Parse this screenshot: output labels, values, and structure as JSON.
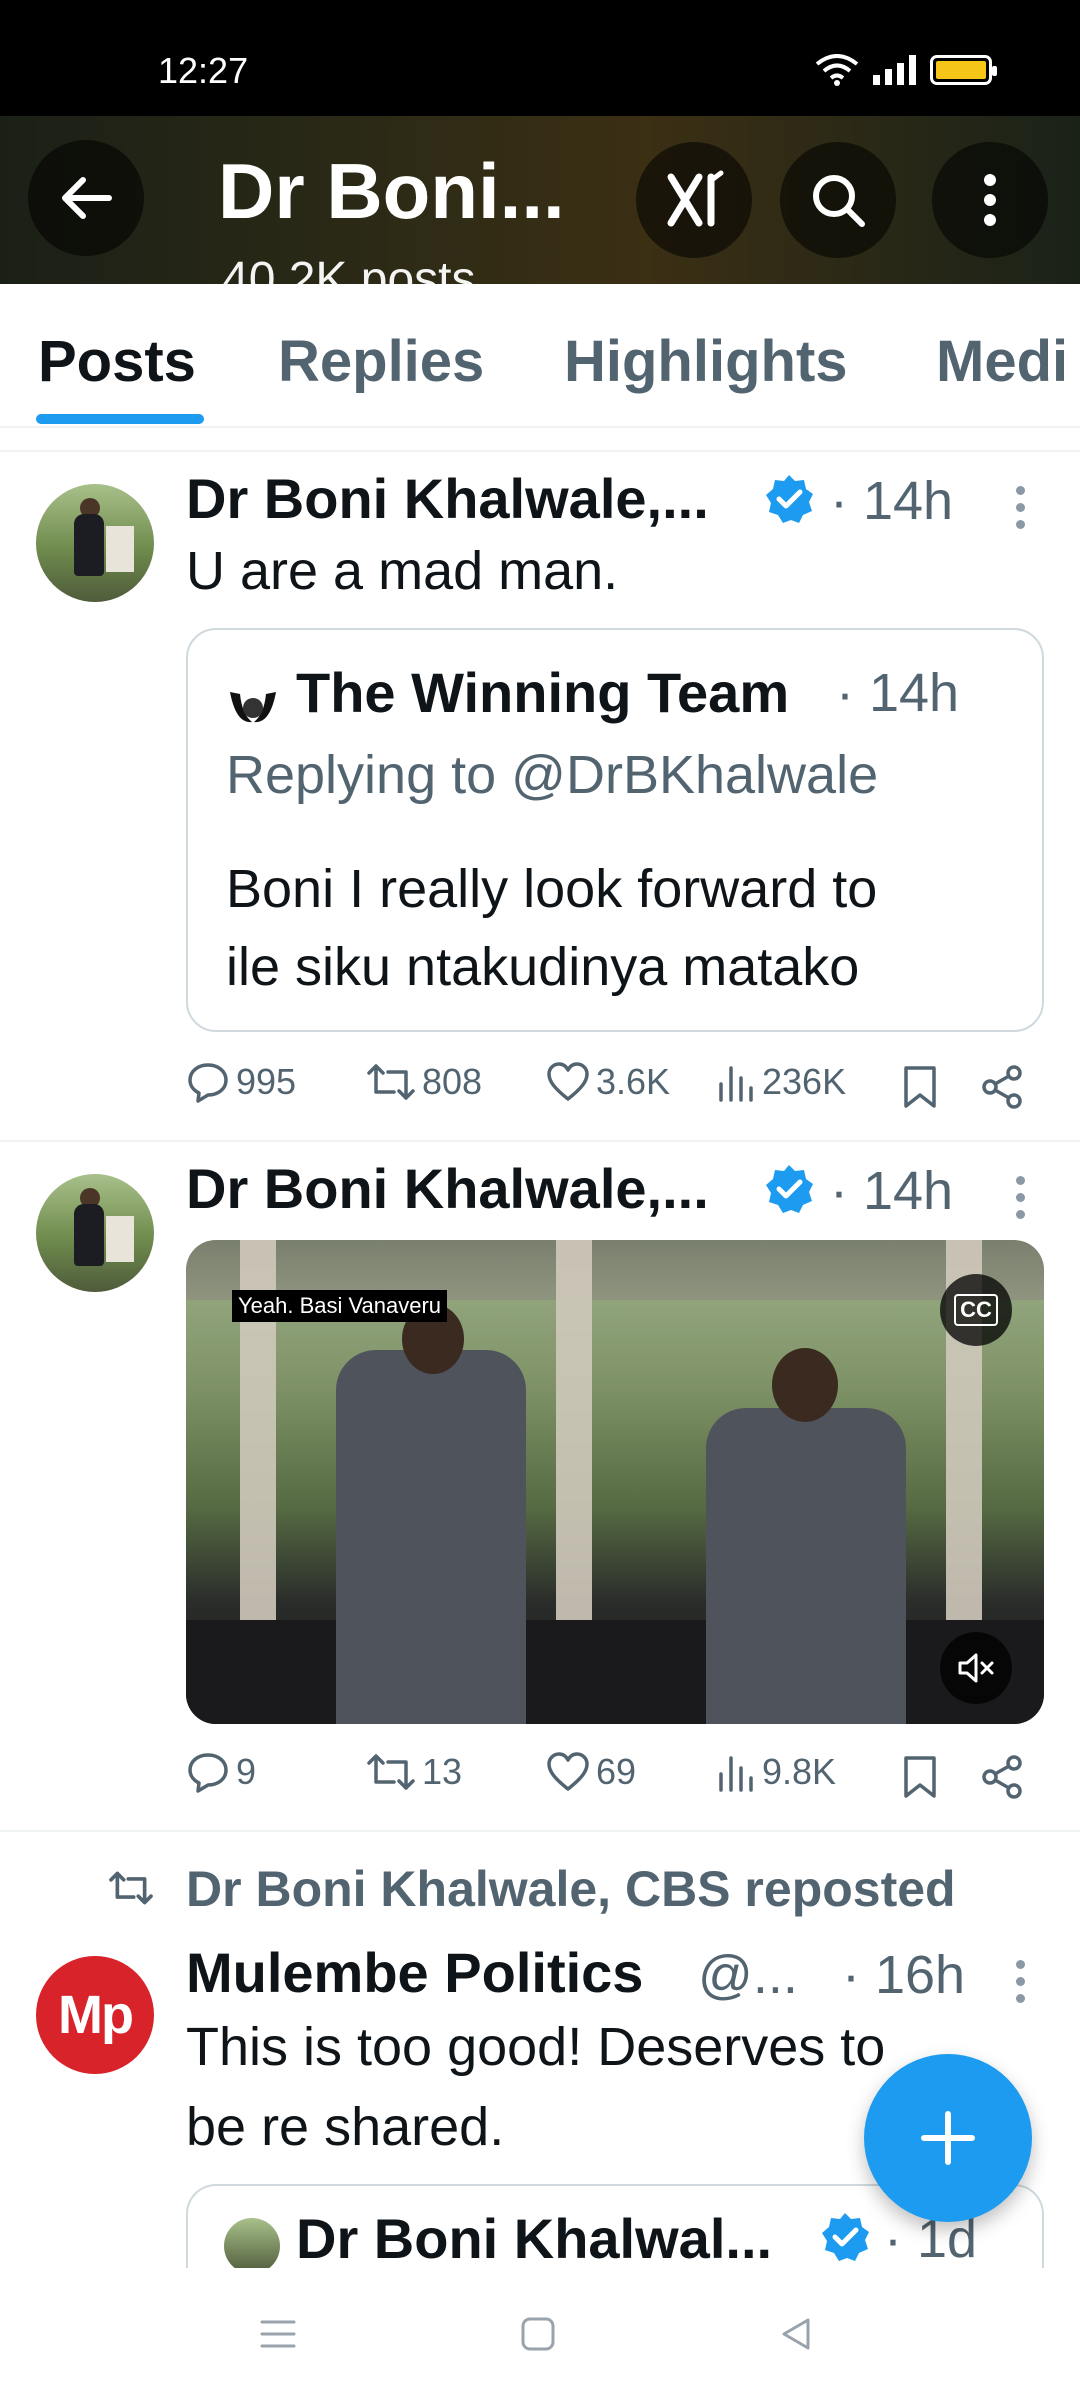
{
  "status_bar": {
    "time": "12:27"
  },
  "header": {
    "title": "Dr Boni...",
    "subtitle": "40.2K posts"
  },
  "tabs": [
    {
      "label": "Posts",
      "active": true
    },
    {
      "label": "Replies",
      "active": false
    },
    {
      "label": "Highlights",
      "active": false
    },
    {
      "label": "Medi",
      "active": false
    }
  ],
  "posts": [
    {
      "author": "Dr Boni Khalwale,...",
      "time": "· 14h",
      "text": "U are a mad man.",
      "quote": {
        "author": "The Winning Team",
        "time": "· 14h",
        "replying": "Replying to @DrBKhalwale",
        "line1": "Boni I really look forward to",
        "line2": "ile siku ntakudinya matako"
      },
      "stats": {
        "replies": "995",
        "reposts": "808",
        "likes": "3.6K",
        "views": "236K"
      }
    },
    {
      "author": "Dr Boni Khalwale,...",
      "time": "· 14h",
      "media": {
        "caption": "Yeah. Basi Vanaveru",
        "cc_label": "CC"
      },
      "stats": {
        "replies": "9",
        "reposts": "13",
        "likes": "69",
        "views": "9.8K"
      }
    },
    {
      "repost_label": "Dr Boni Khalwale, CBS reposted",
      "author": "Mulembe Politics",
      "handle": "@...",
      "time": "· 16h",
      "avatar_text": "Mp",
      "line1": "This is too good! Deserves to",
      "line2": "be re shared.",
      "quote": {
        "author": "Dr Boni Khalwal...",
        "time": "· 1d"
      }
    }
  ],
  "colors": {
    "accent": "#1d9bf0",
    "secondary_text": "#536471",
    "mp_red": "#d8232a"
  }
}
